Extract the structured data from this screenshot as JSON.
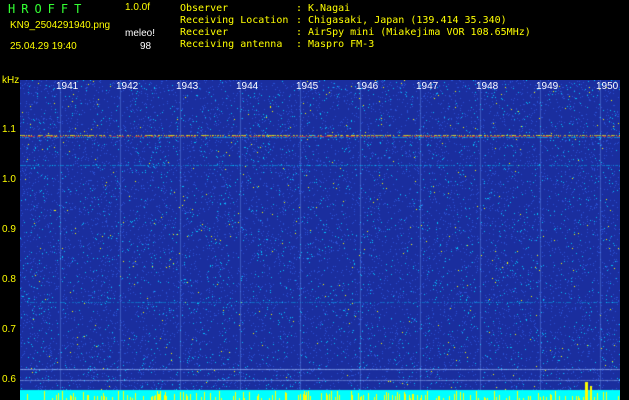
{
  "header": {
    "app_title": "HROFFT",
    "version": "1.0.0f",
    "filename": "KN9_2504291940.png",
    "mode": "meleo!",
    "datetime": "25.04.29 19:40",
    "count": "98"
  },
  "meta": [
    {
      "label": "Observer",
      "sep": ":",
      "value": "K.Nagai"
    },
    {
      "label": "Receiving Location",
      "sep": ":",
      "value": "Chigasaki, Japan (139.414 35.340)"
    },
    {
      "label": "Receiver",
      "sep": ":",
      "value": "AirSpy mini (Miakejima VOR 108.65MHz)"
    },
    {
      "label": "Receiving antenna",
      "sep": ":",
      "value": "Maspro FM-3"
    }
  ],
  "spectrogram": {
    "unit_label": "kHz",
    "y_ticks": [
      {
        "label": "1.1",
        "value": 1.1
      },
      {
        "label": "1.0",
        "value": 1.0
      },
      {
        "label": "0.9",
        "value": 0.9
      },
      {
        "label": "0.8",
        "value": 0.8
      },
      {
        "label": "0.7",
        "value": 0.7
      },
      {
        "label": "0.6",
        "value": 0.6
      }
    ],
    "x_ticks": [
      "1941",
      "1942",
      "1943",
      "1944",
      "1945",
      "1946",
      "1947",
      "1948",
      "1949",
      "1950"
    ],
    "colors": {
      "background": "#1a2e9e",
      "noise_low": "#2a52d6",
      "noise_mid": "#00c8ff",
      "noise_high": "#ffff00",
      "carrier": "#ff3030",
      "baseline_bar": "#00ffff",
      "axis_text": "#ffff00",
      "title_green": "#33ff33"
    }
  }
}
